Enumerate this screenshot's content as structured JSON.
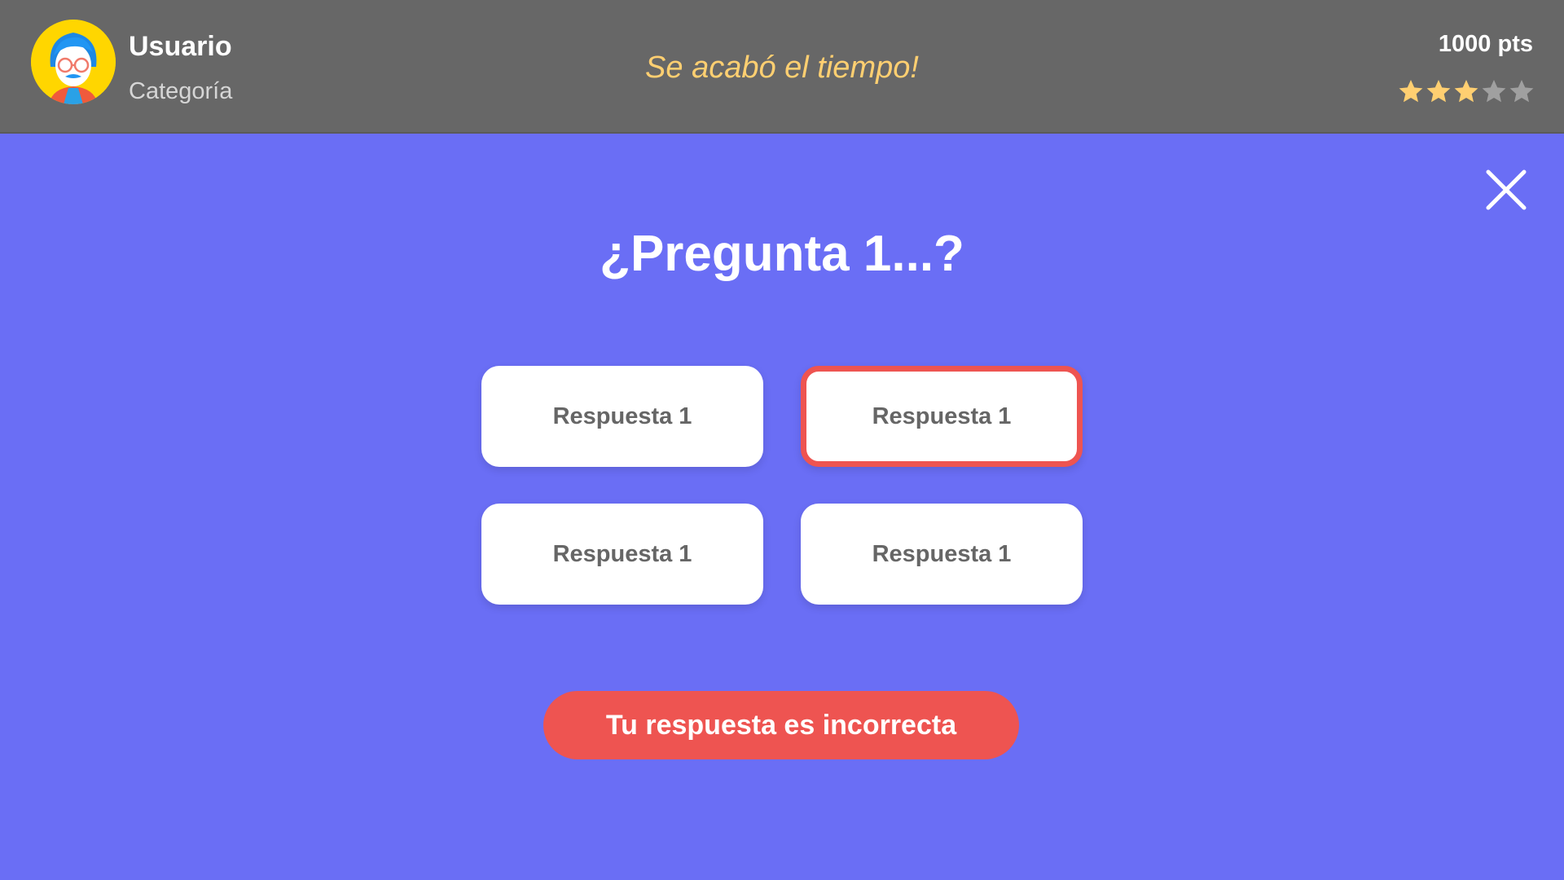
{
  "header": {
    "user_name": "Usuario",
    "user_category": "Categoría",
    "status_message": "Se acabó el tiempo!",
    "score": "1000 pts",
    "rating": {
      "value": 3,
      "max": 5
    }
  },
  "question": {
    "text": "¿Pregunta 1...?"
  },
  "answers": [
    {
      "label": "Respuesta 1",
      "state": "default"
    },
    {
      "label": "Respuesta 1",
      "state": "selected-incorrect"
    },
    {
      "label": "Respuesta 1",
      "state": "default"
    },
    {
      "label": "Respuesta 1",
      "state": "default"
    }
  ],
  "result": {
    "message": "Tu respuesta es incorrecta"
  },
  "colors": {
    "background": "#6a6ef5",
    "header": "#676767",
    "status_text": "#ffcf71",
    "incorrect": "#ee5451",
    "star_on": "#ffcf71",
    "star_off": "#a0a0a0"
  },
  "icons": {
    "avatar": "user-avatar-icon",
    "close": "close-icon",
    "star": "star-icon"
  }
}
